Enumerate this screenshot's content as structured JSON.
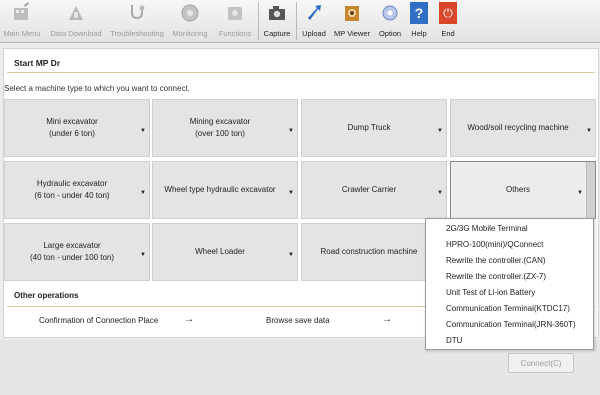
{
  "toolbar": {
    "main_menu": "Main Menu",
    "data_download": "Data Download",
    "troubleshooting": "Troubleshooting",
    "monitoring": "Monitoring",
    "functions": "Functions",
    "capture": "Capture",
    "upload": "Upload",
    "mp_viewer": "MP Viewer",
    "option": "Option",
    "help": "Help",
    "end": "End",
    "help_glyph": "?",
    "end_glyph": "⏻"
  },
  "page": {
    "title": "Start MP Dr",
    "subtitle": "Select a machine type to which you want to connect."
  },
  "machines": {
    "mini_excavator": {
      "line1": "Mini excavator",
      "line2": "(under 6 ton)"
    },
    "mining_excavator": {
      "line1": "Mining excavator",
      "line2": "(over 100 ton)"
    },
    "dump_truck": "Dump Truck",
    "wood_soil": "Wood/soil recycling machine",
    "hydraulic_excavator": {
      "line1": "Hydraulic excavator",
      "line2": "(6 ton - under 40 ton)"
    },
    "wheel_hydraulic": "Wheel type hydraulic excavator",
    "crawler_carrier": "Crawler Carrier",
    "others": "Others",
    "large_excavator": {
      "line1": "Large excavator",
      "line2": "(40 ton - under 100 ton)"
    },
    "wheel_loader": "Wheel Loader",
    "road_construction": "Road construction machine",
    "arrow": "▼"
  },
  "other_operations": {
    "title": "Other operations",
    "confirmation": "Confirmation of Connection Place",
    "browse": "Browse save data",
    "arrow": "→"
  },
  "dropdown_items": [
    "2G/3G Mobile Terminal",
    "HPRO-100(mini)/QConnect",
    "Rewrite the controller.(CAN)",
    "Rewrite the controller.(ZX-7)",
    "Unit Test of Li-ion Battery",
    "Communication Terminal(KTDC17)",
    "Communication Terminal(JRN-360T)",
    "DTU"
  ],
  "connect_button": "Connect(C)",
  "colors": {
    "tile_bg": "#e4e4e4",
    "help_blue": "#2f6fc6",
    "end_red": "#d9472b",
    "rule": "#d9c9a0"
  }
}
